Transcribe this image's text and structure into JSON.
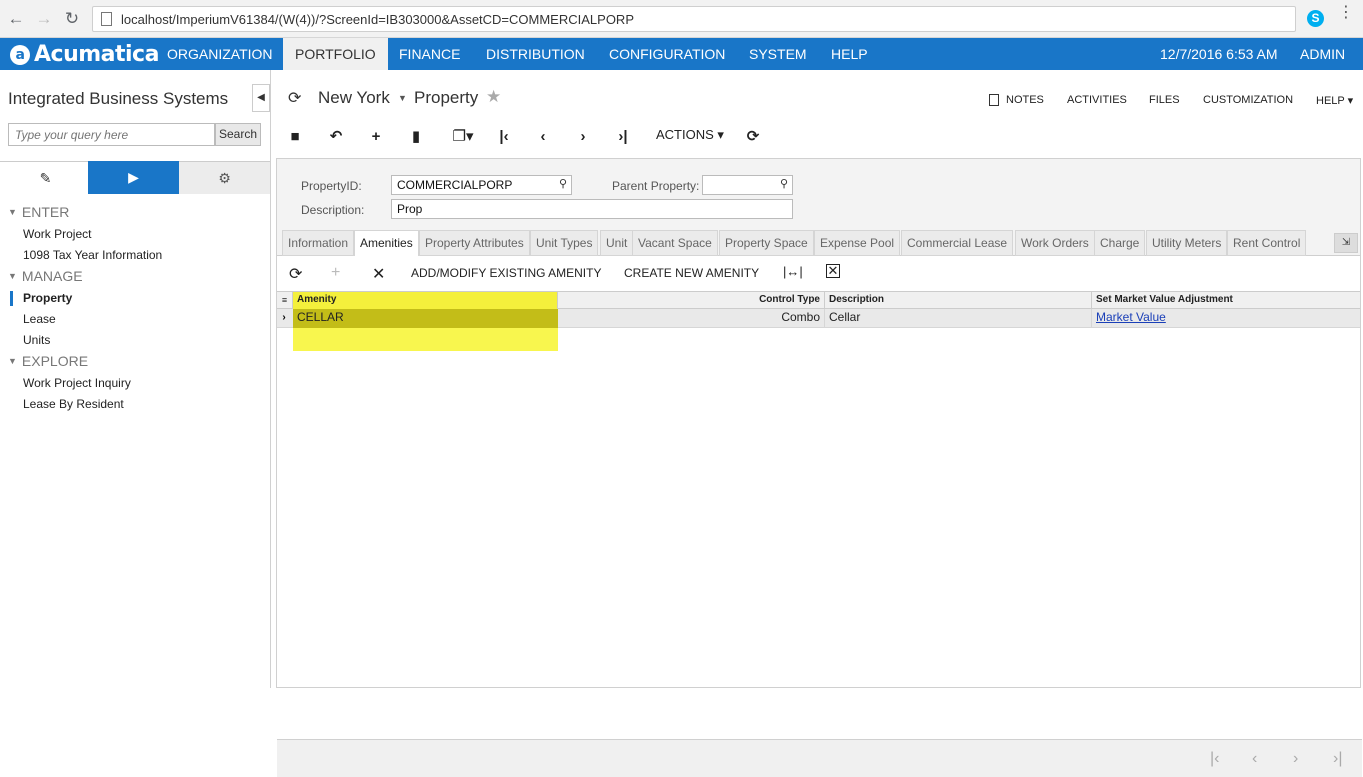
{
  "browser": {
    "url": "localhost/ImperiumV61384/(W(4))/?ScreenId=IB303000&AssetCD=COMMERCIALPORP",
    "back": "←",
    "forward": "→",
    "reload": "↻",
    "skype": "S",
    "menu": "⋮"
  },
  "topnav": {
    "logo": "Acumatica",
    "items": [
      "ORGANIZATION",
      "PORTFOLIO",
      "FINANCE",
      "DISTRIBUTION",
      "CONFIGURATION",
      "SYSTEM",
      "HELP"
    ],
    "active": "PORTFOLIO",
    "datetime": "12/7/2016  6:53 AM",
    "user": "ADMIN"
  },
  "left": {
    "company": "Integrated Business Systems",
    "search_placeholder": "Type your query here",
    "search_button": "Search",
    "sections": [
      {
        "title": "ENTER",
        "items": [
          "Work Project",
          "1098 Tax Year Information"
        ]
      },
      {
        "title": "MANAGE",
        "items": [
          "Property",
          "Lease",
          "Units"
        ]
      },
      {
        "title": "EXPLORE",
        "items": [
          "Work Project Inquiry",
          "Lease By Resident"
        ]
      }
    ],
    "active_item": "Property"
  },
  "header": {
    "location": "New York",
    "screen": "Property",
    "links": [
      "NOTES",
      "ACTIVITIES",
      "FILES",
      "CUSTOMIZATION",
      "HELP"
    ],
    "actions": "ACTIONS"
  },
  "form": {
    "property_id_label": "PropertyID:",
    "property_id_value": "COMMERCIALPORP",
    "parent_label": "Parent Property:",
    "parent_value": "",
    "desc_label": "Description:",
    "desc_value": "Prop"
  },
  "tabs": [
    "Information",
    "Amenities",
    "Property Attributes",
    "Unit Types",
    "Unit",
    "Vacant Space",
    "Property Space",
    "Expense Pool",
    "Commercial Lease",
    "Work Orders",
    "Charge",
    "Utility Meters",
    "Rent Control"
  ],
  "active_tab": "Amenities",
  "grid_toolbar": {
    "add_modify": "ADD/MODIFY EXISTING AMENITY",
    "create_new": "CREATE NEW AMENITY"
  },
  "grid": {
    "columns": [
      "Amenity",
      "Control Type",
      "Description",
      "Set Market Value Adjustment"
    ],
    "rows": [
      {
        "amenity": "CELLAR",
        "control_type": "Combo",
        "description": "Cellar",
        "market": "Market Value"
      }
    ]
  },
  "colors": {
    "accent": "#1976c8",
    "highlight": "#f4f03c"
  }
}
